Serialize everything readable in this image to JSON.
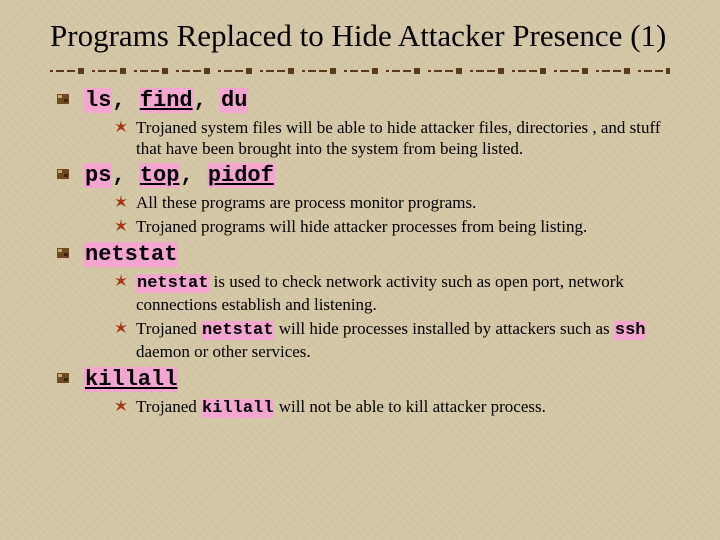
{
  "title": "Programs Replaced to Hide Attacker Presence (1)",
  "colors": {
    "highlight": "#f4a6d0",
    "bullet_dark": "#5b3a1a",
    "bullet_red": "#b03018"
  },
  "items": [
    {
      "head": {
        "parts": [
          {
            "text": "ls",
            "mono": true,
            "hl": true
          },
          {
            "text": ", ",
            "mono": false
          },
          {
            "text": "find",
            "mono": true,
            "hl": true,
            "ul": true
          },
          {
            "text": ", ",
            "mono": false
          },
          {
            "text": "du",
            "mono": true,
            "hl": true
          }
        ]
      },
      "sub": [
        {
          "parts": [
            {
              "text": "Trojaned system files will be able to hide attacker files, directories , and stuff that have been brought into the system from being listed."
            }
          ]
        }
      ]
    },
    {
      "head": {
        "parts": [
          {
            "text": "ps",
            "mono": true,
            "hl": true
          },
          {
            "text": ", ",
            "mono": false
          },
          {
            "text": "top",
            "mono": true,
            "hl": true,
            "ul": true
          },
          {
            "text": ", ",
            "mono": false
          },
          {
            "text": "pidof",
            "mono": true,
            "hl": true,
            "ul": true
          }
        ]
      },
      "sub": [
        {
          "parts": [
            {
              "text": "All these programs are process monitor programs."
            }
          ]
        },
        {
          "parts": [
            {
              "text": "Trojaned programs will hide attacker processes from being listing."
            }
          ]
        }
      ]
    },
    {
      "head": {
        "parts": [
          {
            "text": "netstat",
            "mono": true,
            "hl": true
          }
        ]
      },
      "sub": [
        {
          "parts": [
            {
              "text": "netstat",
              "mono": true,
              "hl": true
            },
            {
              "text": " is used to check network activity such as open port, network connections establish and listening."
            }
          ]
        },
        {
          "parts": [
            {
              "text": "Trojaned "
            },
            {
              "text": "netstat",
              "mono": true,
              "hl": true
            },
            {
              "text": " will hide processes installed by attackers such as "
            },
            {
              "text": "ssh",
              "mono": true,
              "hl": true
            },
            {
              "text": " daemon or other services."
            }
          ]
        }
      ]
    },
    {
      "head": {
        "parts": [
          {
            "text": "killall",
            "mono": true,
            "hl": true,
            "ul": true
          }
        ]
      },
      "sub": [
        {
          "parts": [
            {
              "text": "Trojaned "
            },
            {
              "text": "killall",
              "mono": true,
              "hl": true
            },
            {
              "text": " will not be able to kill attacker process."
            }
          ]
        }
      ]
    }
  ]
}
